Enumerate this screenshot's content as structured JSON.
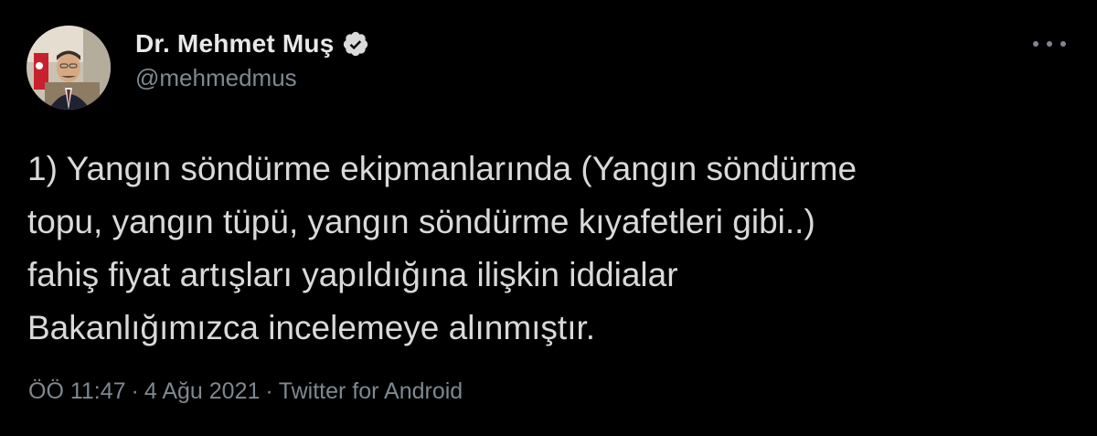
{
  "author": {
    "display_name": "Dr. Mehmet Muş",
    "handle": "@mehmedmus",
    "verified": true
  },
  "tweet": {
    "lines": [
      "1) Yangın söndürme ekipmanlarında (Yangın söndürme",
      "topu, yangın tüpü, yangın söndürme kıyafetleri gibi..)",
      "fahiş fiyat artışları yapıldığına ilişkin iddialar",
      "Bakanlığımızca incelemeye alınmıştır."
    ]
  },
  "meta": {
    "time": "ÖÖ 11:47",
    "separator": "·",
    "date": "4 Ağu 2021",
    "source": "Twitter for Android"
  },
  "colors": {
    "background": "#000000",
    "text_primary": "#d9d9d9",
    "text_secondary": "#7f8890"
  },
  "icons": {
    "verified": "verified-badge-icon",
    "more": "more-options-icon"
  }
}
